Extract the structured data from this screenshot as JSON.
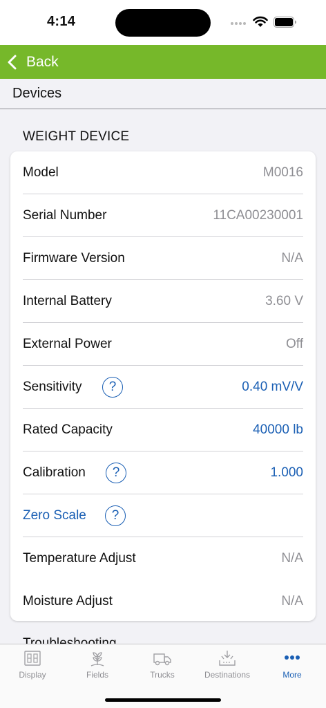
{
  "status": {
    "time": "4:14"
  },
  "nav": {
    "back_label": "Back"
  },
  "page": {
    "title": "Devices"
  },
  "section": {
    "header": "WEIGHT DEVICE"
  },
  "rows": [
    {
      "label": "Model",
      "value": "M0016",
      "help": ""
    },
    {
      "label": "Serial Number",
      "value": "11CA00230001",
      "help": ""
    },
    {
      "label": "Firmware Version",
      "value": "N/A",
      "help": ""
    },
    {
      "label": "Internal Battery",
      "value": "3.60 V",
      "help": ""
    },
    {
      "label": "External Power",
      "value": "Off",
      "help": ""
    },
    {
      "label": "Sensitivity",
      "value": "0.40 mV/V",
      "help": "?"
    },
    {
      "label": "Rated Capacity",
      "value": "40000 lb",
      "help": ""
    },
    {
      "label": "Calibration",
      "value": "1.000",
      "help": "?"
    },
    {
      "label": "Zero Scale",
      "value": "",
      "help": "?"
    },
    {
      "label": "Temperature Adjust",
      "value": "N/A",
      "help": ""
    },
    {
      "label": "Moisture Adjust",
      "value": "N/A",
      "help": ""
    }
  ],
  "next_section": {
    "label": "Troubleshooting"
  },
  "tabs": [
    {
      "label": "Display",
      "icon": "display-icon"
    },
    {
      "label": "Fields",
      "icon": "fields-icon"
    },
    {
      "label": "Trucks",
      "icon": "truck-icon"
    },
    {
      "label": "Destinations",
      "icon": "destinations-icon"
    },
    {
      "label": "More",
      "icon": "more-icon"
    }
  ],
  "colors": {
    "brand_green": "#76b82a",
    "link_blue": "#1a5fb4",
    "secondary_gray": "#8e8e93"
  }
}
